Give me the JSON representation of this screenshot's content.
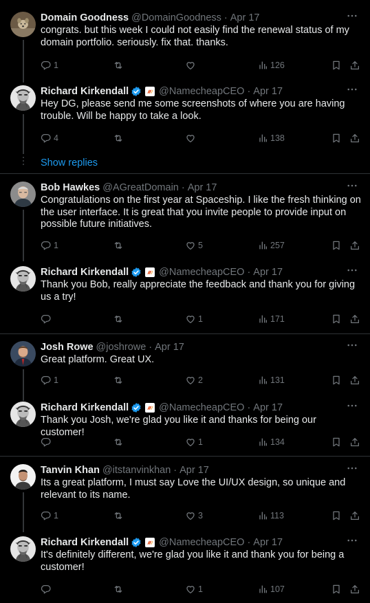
{
  "colors": {
    "background": "#000000",
    "text": "#e7e9ea",
    "muted": "#71767b",
    "link": "#1d9bf0",
    "verified": "#1d9bf0",
    "divider": "#2f3336"
  },
  "threads": [
    {
      "tweet": {
        "name": "Domain Goodness",
        "handle": "@DomainGoodness",
        "date": "Apr 17",
        "text": "congrats. but this week I could not easily find the renewal status of my domain portfolio. seriously. fix that. thanks.",
        "replies": "1",
        "retweets": "",
        "likes": "",
        "views": "126",
        "avatar": "dog-avatar"
      },
      "reply": {
        "name": "Richard Kirkendall",
        "handle": "@NamecheapCEO",
        "date": "Apr 17",
        "text": "Hey DG, please send me some screenshots of where you are having trouble. Will be happy to take a look.",
        "replies": "4",
        "retweets": "",
        "likes": "",
        "views": "138",
        "avatar": "sketch-face-avatar"
      },
      "show_replies": "Show replies"
    },
    {
      "tweet": {
        "name": "Bob Hawkes",
        "handle": "@AGreatDomain",
        "date": "Apr 17",
        "text": "Congratulations on the first year at Spaceship. I like the fresh thinking on the user interface. It is great that you invite people to provide input on possible future initiatives.",
        "replies": "1",
        "retweets": "",
        "likes": "5",
        "views": "257",
        "avatar": "bob-avatar"
      },
      "reply": {
        "name": "Richard Kirkendall",
        "handle": "@NamecheapCEO",
        "date": "Apr 17",
        "text": "Thank you Bob, really appreciate the feedback and thank you for giving us a try!",
        "replies": "",
        "retweets": "",
        "likes": "1",
        "views": "171",
        "avatar": "sketch-face-avatar"
      }
    },
    {
      "tweet": {
        "name": "Josh Rowe",
        "handle": "@joshrowe",
        "date": "Apr 17",
        "text": "Great platform. Great UX.",
        "replies": "1",
        "retweets": "",
        "likes": "2",
        "views": "131",
        "avatar": "josh-avatar"
      },
      "reply": {
        "name": "Richard Kirkendall",
        "handle": "@NamecheapCEO",
        "date": "Apr 17",
        "text": "Thank you Josh, we're glad you like it and thanks for being our customer!",
        "replies": "",
        "retweets": "",
        "likes": "1",
        "views": "134",
        "avatar": "sketch-face-avatar"
      }
    },
    {
      "tweet": {
        "name": "Tanvin Khan",
        "handle": "@itstanvinkhan",
        "date": "Apr 17",
        "text": "Its a great platform, I must say Love the UI/UX design,  so unique and relevant to its name.",
        "replies": "1",
        "retweets": "",
        "likes": "3",
        "views": "113",
        "avatar": "tanvin-avatar"
      },
      "reply": {
        "name": "Richard Kirkendall",
        "handle": "@NamecheapCEO",
        "date": "Apr 17",
        "text": "It's definitely different, we're glad you like it and thank you for being a customer!",
        "replies": "",
        "retweets": "",
        "likes": "1",
        "views": "107",
        "avatar": "sketch-face-avatar"
      }
    }
  ]
}
